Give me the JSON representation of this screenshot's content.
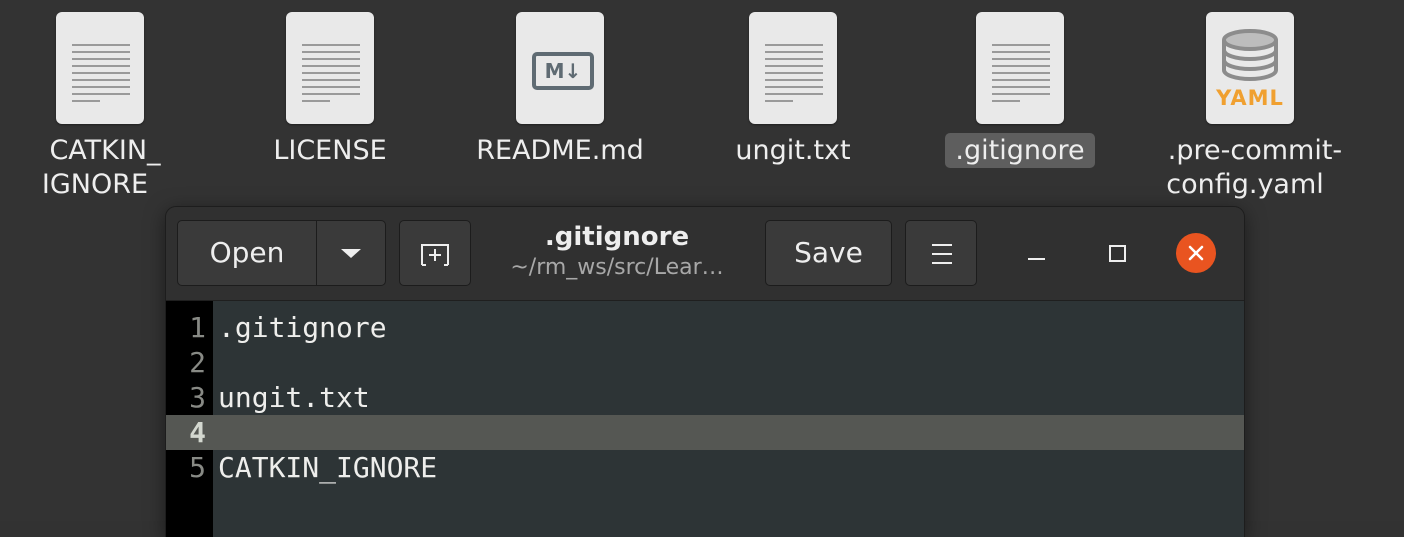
{
  "desktop": {
    "files": [
      {
        "label": "CATKIN_\nIGNORE",
        "icon": "text-file-icon",
        "selected": false
      },
      {
        "label": "LICENSE",
        "icon": "text-file-icon",
        "selected": false
      },
      {
        "label": "README.md",
        "icon": "markdown-file-icon",
        "selected": false
      },
      {
        "label": "ungit.txt",
        "icon": "text-file-icon",
        "selected": false
      },
      {
        "label": ".gitignore",
        "icon": "text-file-icon",
        "selected": true
      },
      {
        "label": ".pre-commit-\nconfig.yaml",
        "icon": "yaml-file-icon",
        "selected": false
      }
    ],
    "md_badge": "M↓",
    "yaml_badge": "YAML"
  },
  "editor_window": {
    "open_label": "Open",
    "save_label": "Save",
    "title": ".gitignore",
    "subtitle": "~/rm_ws/src/Lear…",
    "accent": "#e95420",
    "current_line": 4
  },
  "document": {
    "lines": [
      {
        "number": "1",
        "text": ".gitignore"
      },
      {
        "number": "2",
        "text": ""
      },
      {
        "number": "3",
        "text": "ungit.txt"
      },
      {
        "number": "4",
        "text": ""
      },
      {
        "number": "5",
        "text": "CATKIN_IGNORE"
      }
    ]
  }
}
